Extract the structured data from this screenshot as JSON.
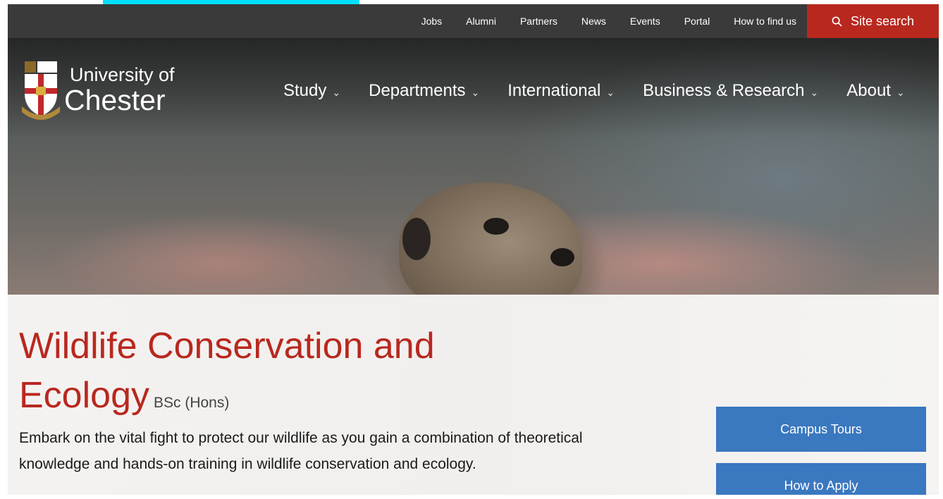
{
  "top_links": [
    "Jobs",
    "Alumni",
    "Partners",
    "News",
    "Events",
    "Portal",
    "How to find us"
  ],
  "site_search": {
    "icon": "search-icon",
    "label": "Site search"
  },
  "logo": {
    "line1": "University of",
    "line2": "Chester"
  },
  "main_nav": [
    {
      "label": "Study"
    },
    {
      "label": "Departments"
    },
    {
      "label": "International"
    },
    {
      "label": "Business & Research"
    },
    {
      "label": "About"
    }
  ],
  "course": {
    "title_line1": "Wildlife Conservation and",
    "title_line2": "Ecology",
    "degree": "BSc (Hons)",
    "intro": "Embark on the vital fight to protect our wildlife as you gain a combination of theoretical knowledge and hands-on training in wildlife conservation and ecology."
  },
  "buttons": {
    "campus_tours": "Campus Tours",
    "how_to_apply": "How to Apply"
  },
  "colors": {
    "brand_red": "#b8281f",
    "button_blue": "#3a78bf",
    "top_bar": "#3a3a3a"
  }
}
